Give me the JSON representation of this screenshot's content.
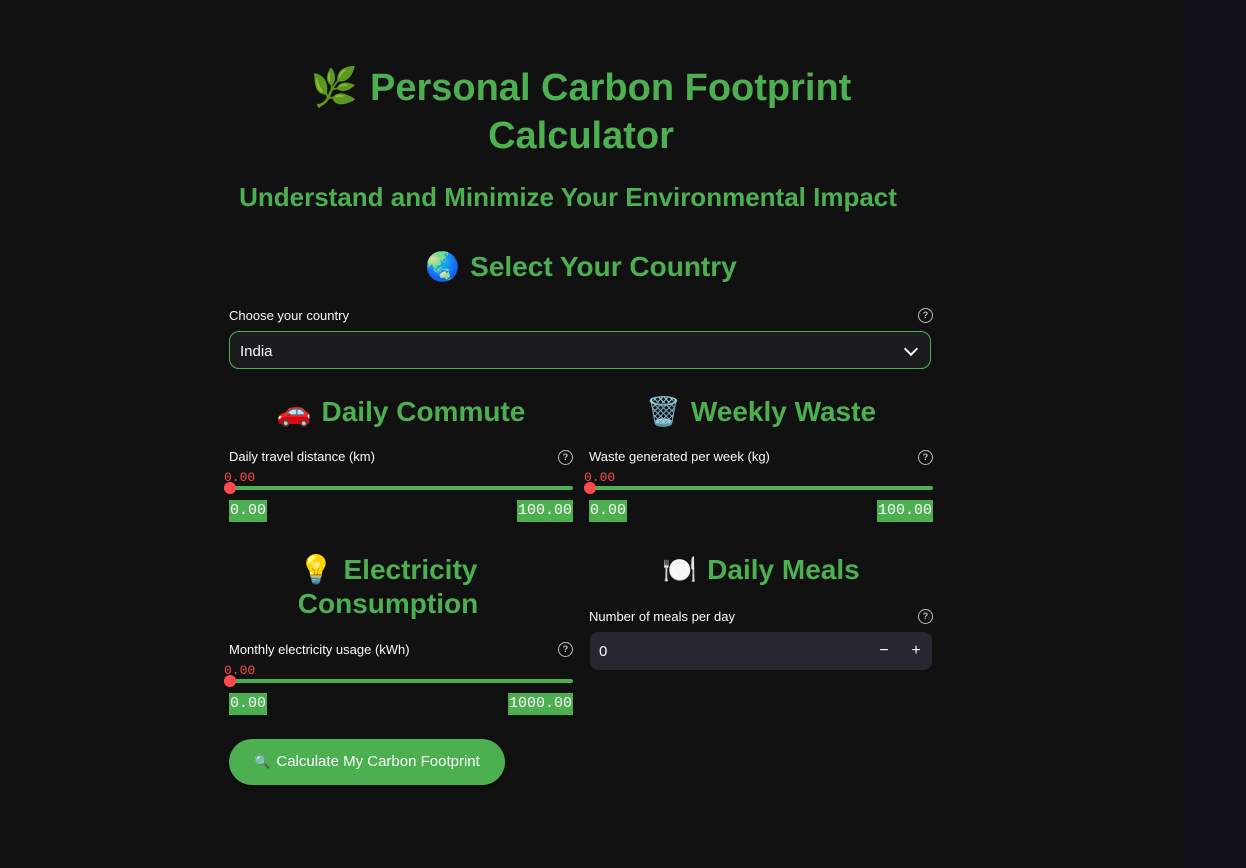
{
  "page": {
    "title_icon": "🌿",
    "title": "Personal Carbon Footprint Calculator",
    "subtitle": "Understand and Minimize Your Environmental Impact"
  },
  "country": {
    "heading_icon": "🌏",
    "heading": "Select Your Country",
    "label": "Choose your country",
    "selected": "India"
  },
  "commute": {
    "heading_icon": "🚗",
    "heading": "Daily Commute",
    "label": "Daily travel distance (km)",
    "value": "0.00",
    "min": "0.00",
    "max": "100.00"
  },
  "waste": {
    "heading_icon": "🗑️",
    "heading": "Weekly Waste",
    "label": "Waste generated per week (kg)",
    "value": "0.00",
    "min": "0.00",
    "max": "100.00"
  },
  "electricity": {
    "heading_icon": "💡",
    "heading_line1": "Electricity",
    "heading_line2": "Consumption",
    "label": "Monthly electricity usage (kWh)",
    "value": "0.00",
    "min": "0.00",
    "max": "1000.00"
  },
  "meals": {
    "heading_icon": "🍽️",
    "heading": "Daily Meals",
    "label": "Number of meals per day",
    "value": "0",
    "minus": "−",
    "plus": "+"
  },
  "action": {
    "icon": "🔍",
    "label": "Calculate My Carbon Footprint"
  },
  "help_glyph": "?",
  "colors": {
    "accent": "#4caf50",
    "slider_thumb": "#ff4b4b",
    "background": "#111112"
  }
}
